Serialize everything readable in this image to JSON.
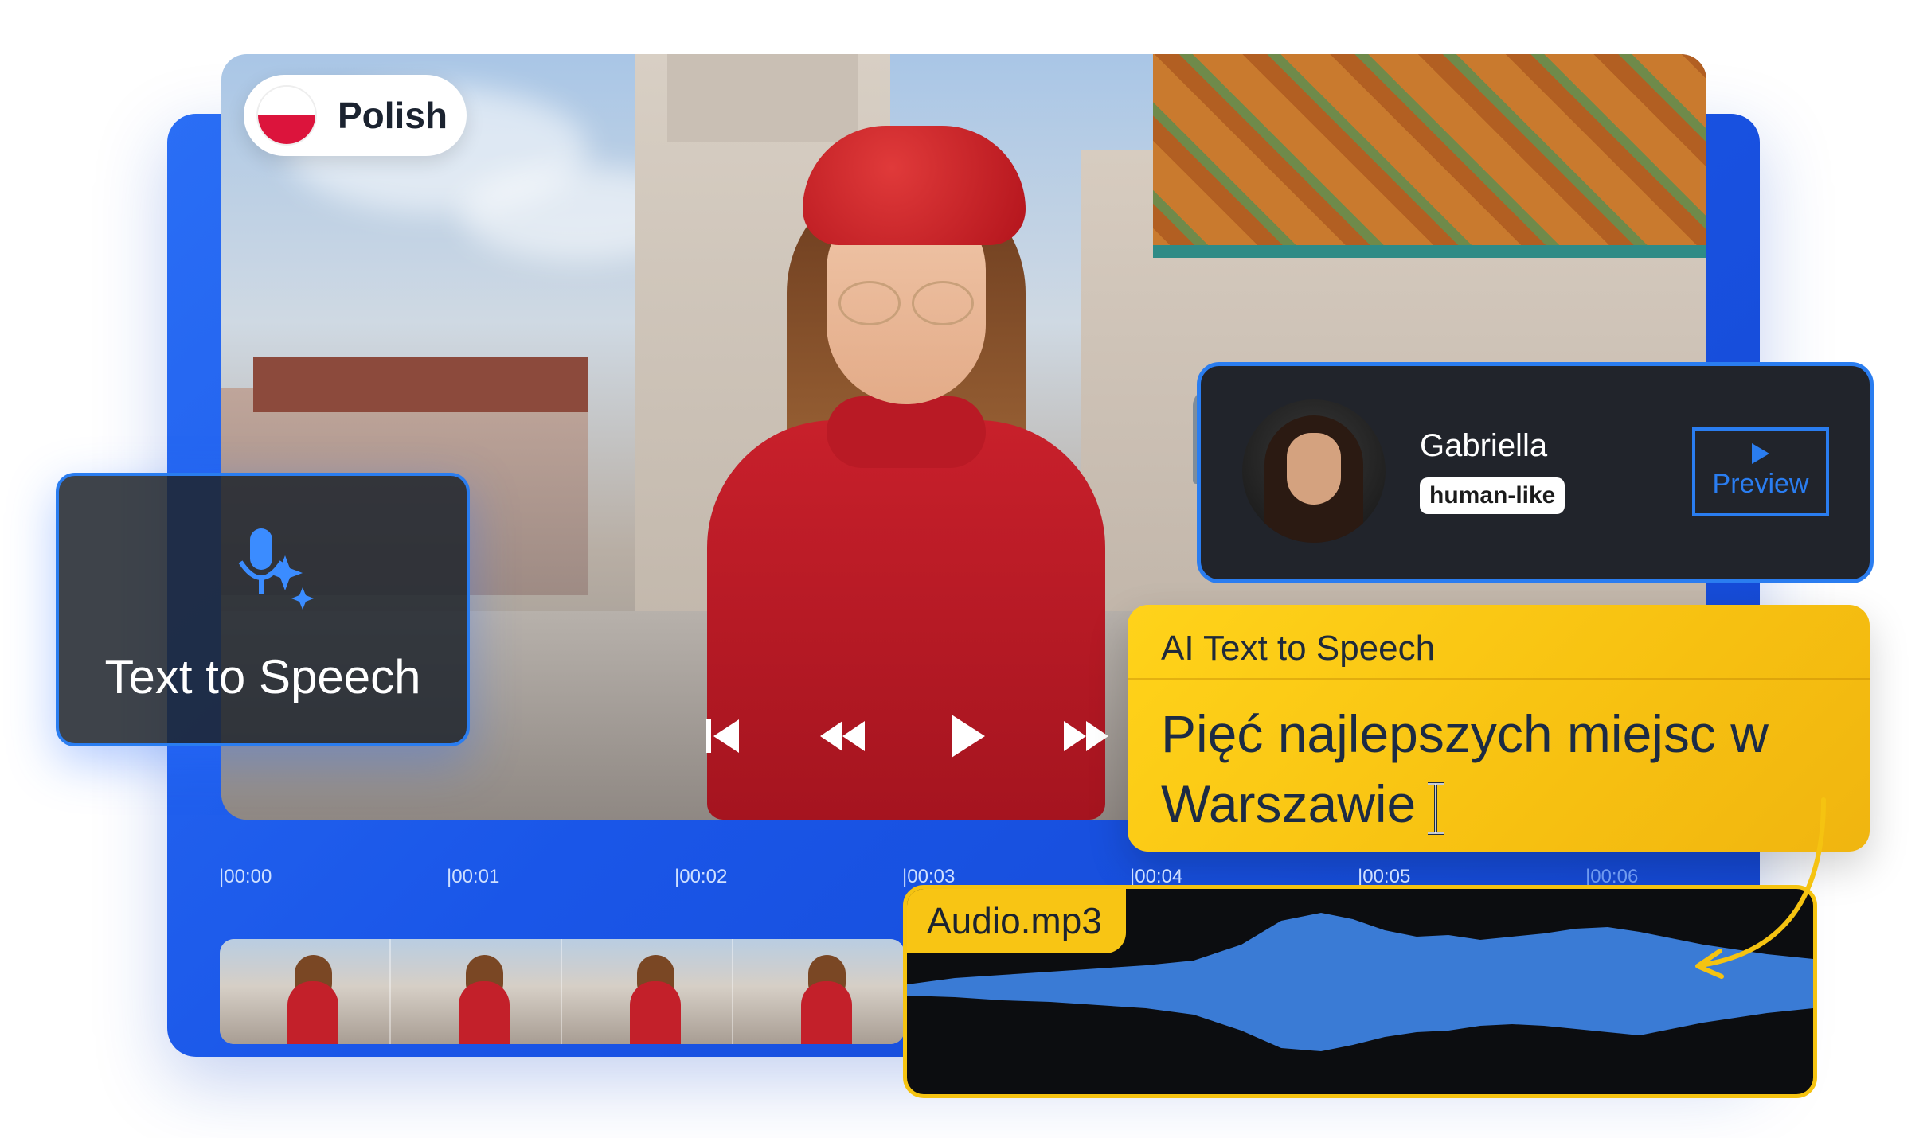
{
  "language": {
    "label": "Polish"
  },
  "feature_card": {
    "label": "Text to Speech",
    "icon": "voice-sparkle-icon"
  },
  "voice": {
    "name": "Gabriella",
    "tag": "human-like",
    "preview_label": "Preview"
  },
  "ai_panel": {
    "title": "AI Text to Speech",
    "text": "Pięć najlepszych miejsc w Warszawie"
  },
  "timeline": {
    "ticks": [
      "|00:00",
      "|00:01",
      "|00:02",
      "|00:03",
      "|00:04",
      "|00:05",
      "|00:06"
    ]
  },
  "audio": {
    "filename": "Audio.mp3"
  },
  "controls": [
    "skip-back-icon",
    "rewind-icon",
    "play-icon",
    "fast-forward-icon"
  ],
  "colors": {
    "accent_blue": "#2a6ef5",
    "accent_yellow": "#f8c514",
    "dark_panel": "#21242b"
  }
}
